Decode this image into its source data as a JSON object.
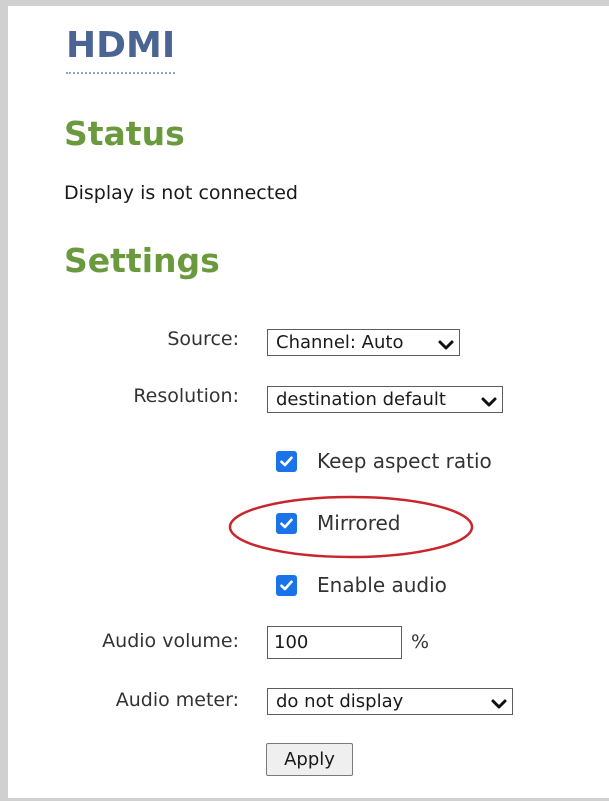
{
  "page": {
    "title": "HDMI"
  },
  "status": {
    "heading": "Status",
    "text": "Display is not connected"
  },
  "settings": {
    "heading": "Settings",
    "source": {
      "label": "Source:",
      "value": "Channel: Auto",
      "icon": "chevron-down-icon"
    },
    "resolution": {
      "label": "Resolution:",
      "value": "destination default",
      "icon": "chevron-down-icon"
    },
    "checkboxes": [
      {
        "label": "Keep aspect ratio",
        "checked": true
      },
      {
        "label": "Mirrored",
        "checked": true
      },
      {
        "label": "Enable audio",
        "checked": true
      }
    ],
    "audio_volume": {
      "label": "Audio volume:",
      "value": "100",
      "unit": "%"
    },
    "audio_meter": {
      "label": "Audio meter:",
      "value": "do not display",
      "icon": "chevron-down-icon"
    },
    "apply_label": "Apply"
  },
  "colors": {
    "title": "#4a6593",
    "section_heading": "#6b9a3e",
    "checkbox_accent": "#1a73e8",
    "highlight": "#c8262d",
    "frame_border": "#d0d0d0"
  }
}
